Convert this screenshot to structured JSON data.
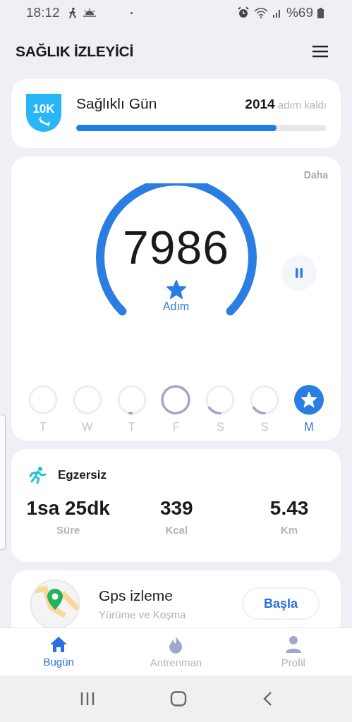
{
  "status_bar": {
    "time": "18:12",
    "battery": "%69"
  },
  "header": {
    "title": "SAĞLIK İZLEYİCİ"
  },
  "goal_card": {
    "badge": "10K",
    "title": "Sağlıklı Gün",
    "remaining": "2014",
    "remaining_label": "adım kaldı",
    "level": 0.8
  },
  "steps_card": {
    "more": "Daha",
    "steps": "7986",
    "unit": "Adım",
    "paused": false,
    "days": [
      {
        "label": "T",
        "selected": false
      },
      {
        "label": "W",
        "selected": false
      },
      {
        "label": "T",
        "selected": false
      },
      {
        "label": "F",
        "selected": false
      },
      {
        "label": "S",
        "selected": false
      },
      {
        "label": "S",
        "selected": false
      },
      {
        "label": "M",
        "selected": true
      }
    ]
  },
  "exercise_card": {
    "title": "Egzersiz",
    "stats": [
      {
        "value": "1sa 25dk",
        "label": "Süre"
      },
      {
        "value": "339",
        "label": "Kcal"
      },
      {
        "value": "5.43",
        "label": "Km"
      }
    ]
  },
  "gps_card": {
    "title": "Gps izleme",
    "subtitle": "Yürüme ve Koşma",
    "button": "Başla"
  },
  "bottom_nav": [
    {
      "label": "Bugün",
      "selected": true
    },
    {
      "label": "Antrenman",
      "selected": false
    },
    {
      "label": "Profil",
      "selected": false
    }
  ]
}
